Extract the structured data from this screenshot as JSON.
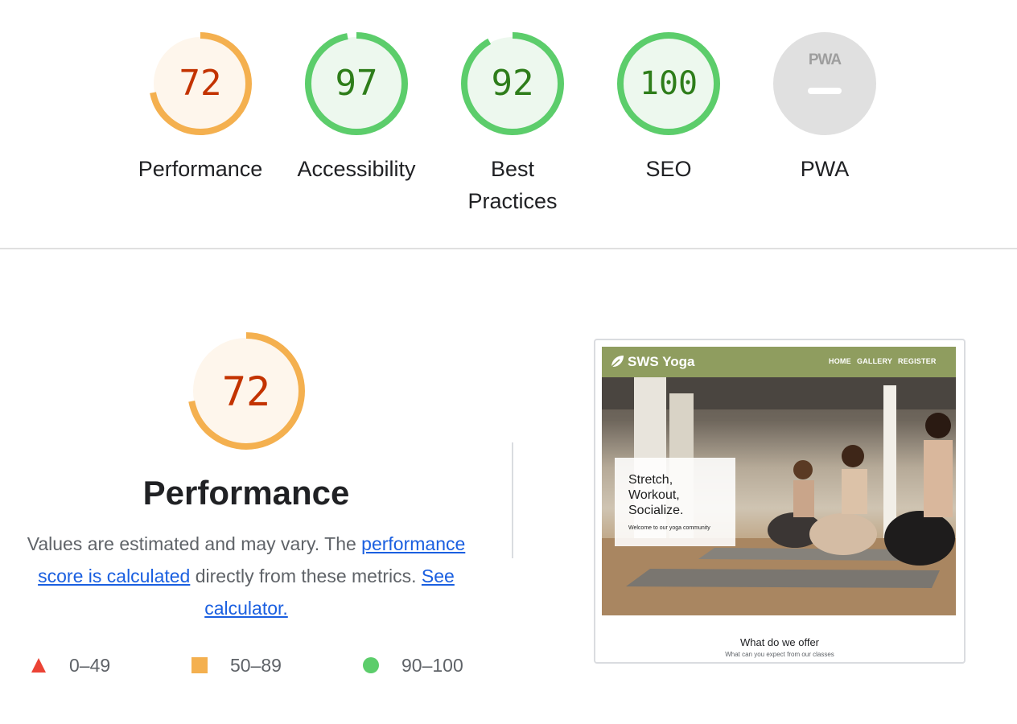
{
  "summary": {
    "gauges": [
      {
        "label": "Performance",
        "score": "72",
        "value": 72,
        "status": "average"
      },
      {
        "label": "Accessibility",
        "score": "97",
        "value": 97,
        "status": "pass"
      },
      {
        "label": "Best Practices",
        "label_line1": "Best",
        "label_line2": "Practices",
        "score": "92",
        "value": 92,
        "status": "pass"
      },
      {
        "label": "SEO",
        "score": "100",
        "value": 100,
        "status": "pass"
      },
      {
        "label": "PWA",
        "badge_text": "PWA",
        "status": "not-applicable"
      }
    ]
  },
  "performance": {
    "score": "72",
    "value": 72,
    "title": "Performance",
    "description_text": "Values are estimated and may vary. The ",
    "link1": "performance score is calculated",
    "middle_text": " directly from these metrics.",
    "link2": "See calculator.",
    "legend": [
      {
        "range": "0–49",
        "shape": "triangle",
        "color": "#eb4335"
      },
      {
        "range": "50–89",
        "shape": "square",
        "color": "#f4b04f"
      },
      {
        "range": "90–100",
        "shape": "circle",
        "color": "#5ccd6b"
      }
    ]
  },
  "thumbnail": {
    "site_title": "SWS Yoga",
    "nav": [
      "HOME",
      "GALLERY",
      "REGISTER"
    ],
    "hero_lines": [
      "Stretch,",
      "Workout,",
      "Socialize."
    ],
    "hero_subtitle": "Welcome to our yoga community",
    "section_title": "What do we offer",
    "section_subtitle": "What can you expect from our classes"
  },
  "colors": {
    "average": "#f4b04f",
    "average_text": "#c33300",
    "average_bg": "#fef6ec",
    "pass": "#5ccd6b",
    "pass_text": "#2e7d1a",
    "pass_bg": "#edf8ee",
    "na": "#e0e0e0",
    "link": "#1a5fe0"
  }
}
